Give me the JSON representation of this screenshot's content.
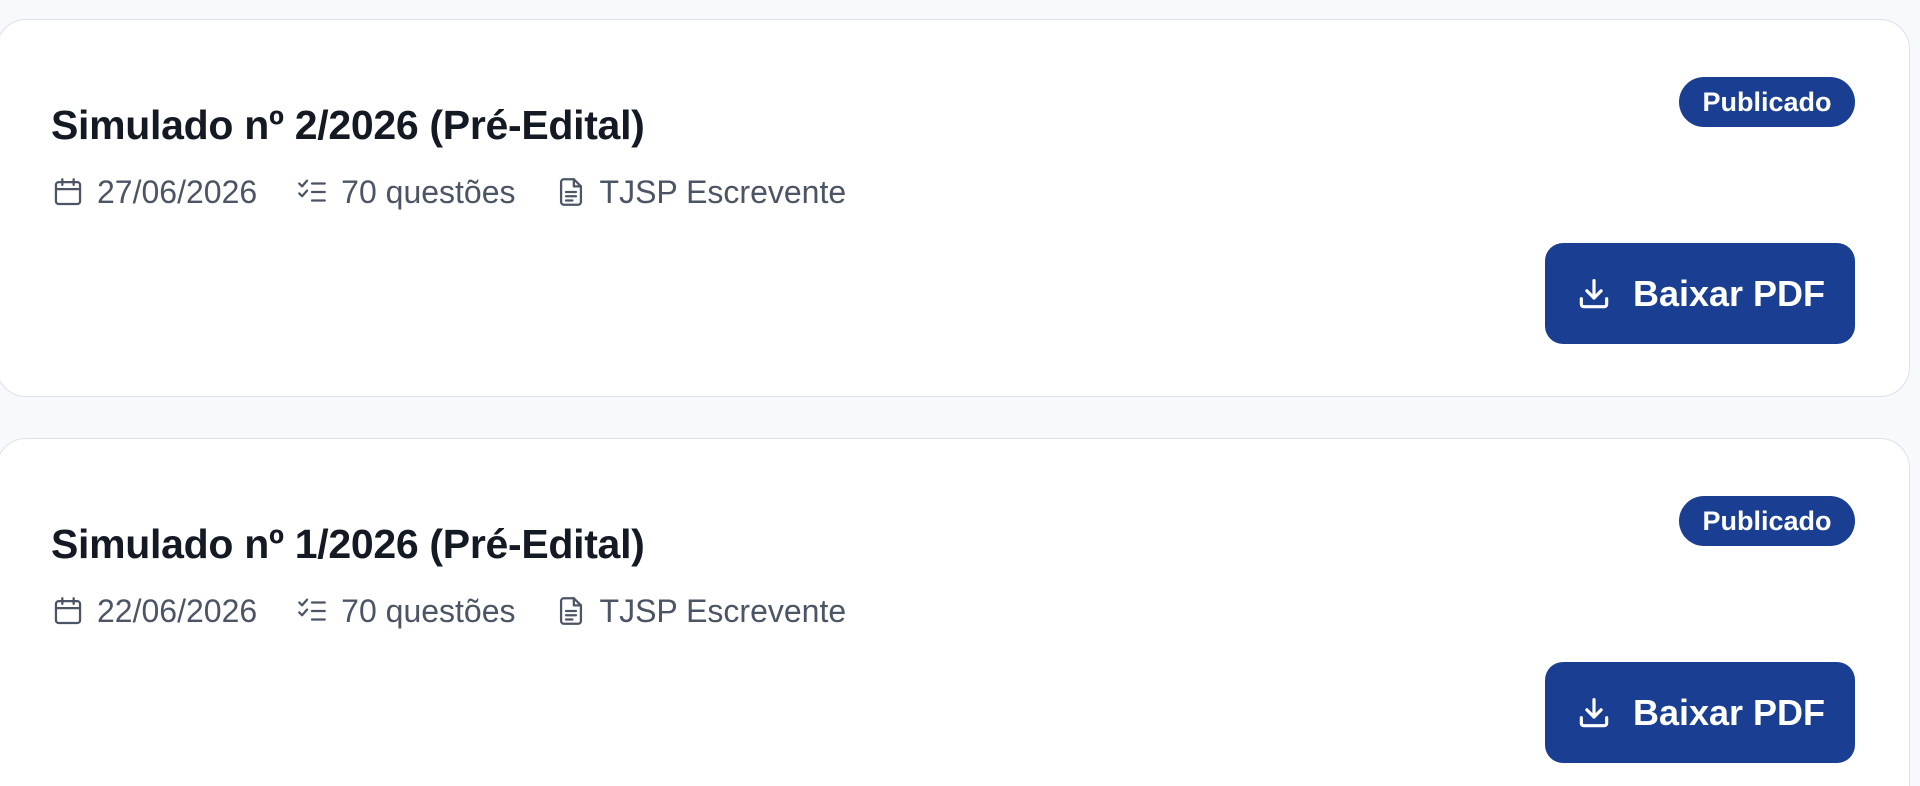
{
  "simulados": [
    {
      "title": "Simulado nº 2/2026 (Pré-Edital)",
      "status": "Publicado",
      "date": "27/06/2026",
      "questions": "70 questões",
      "exam": "TJSP Escrevente",
      "download_label": "Baixar PDF"
    },
    {
      "title": "Simulado nº 1/2026 (Pré-Edital)",
      "status": "Publicado",
      "date": "22/06/2026",
      "questions": "70 questões",
      "exam": "TJSP Escrevente",
      "download_label": "Baixar PDF"
    }
  ],
  "icons": {
    "date": "calendar-icon",
    "questions": "checklist-icon",
    "exam": "document-icon",
    "download": "download-icon"
  },
  "colors": {
    "primary": "#1a3e91",
    "title_text": "#141a24",
    "meta_text": "#4b5565",
    "page_background": "#f7f9fc",
    "card_background": "#ffffff",
    "card_border": "#dde2ea"
  }
}
